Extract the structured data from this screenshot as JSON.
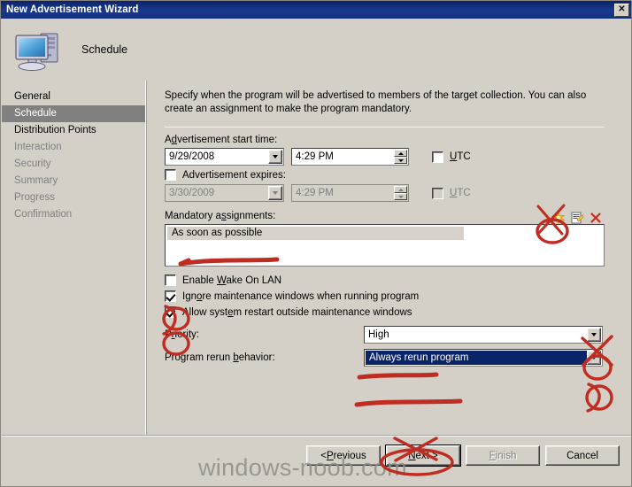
{
  "window": {
    "title": "New Advertisement Wizard",
    "close_label": "✕"
  },
  "header": {
    "title": "Schedule",
    "icon": "computer-icon"
  },
  "sidebar": {
    "items": [
      {
        "label": "General",
        "state": "enabled"
      },
      {
        "label": "Schedule",
        "state": "active"
      },
      {
        "label": "Distribution Points",
        "state": "enabled"
      },
      {
        "label": "Interaction",
        "state": "disabled"
      },
      {
        "label": "Security",
        "state": "disabled"
      },
      {
        "label": "Summary",
        "state": "disabled"
      },
      {
        "label": "Progress",
        "state": "disabled"
      },
      {
        "label": "Confirmation",
        "state": "disabled"
      }
    ]
  },
  "main": {
    "intro": "Specify when the program will be advertised to members of the target collection. You can also create an assignment to make the program mandatory.",
    "start_time": {
      "label": "Advertisement start time:",
      "date_value": "9/29/2008",
      "time_value": "4:29 PM",
      "utc_label": "UTC",
      "utc_checked": false
    },
    "expires": {
      "checkbox_label": "Advertisement expires:",
      "checked": false,
      "date_value": "3/30/2009",
      "time_value": "4:29 PM",
      "utc_label": "UTC",
      "utc_checked": false
    },
    "mandatory": {
      "label": "Mandatory assignments:",
      "items": [
        "As soon as possible"
      ],
      "toolbar": [
        {
          "name": "new-assignment-icon",
          "title": "New"
        },
        {
          "name": "properties-icon",
          "title": "Properties"
        },
        {
          "name": "delete-icon",
          "title": "Delete"
        }
      ]
    },
    "checkboxes": [
      {
        "label": "Enable Wake On LAN",
        "checked": false,
        "name": "enable-wake-on-lan"
      },
      {
        "label": "Ignore maintenance windows when running program",
        "checked": true,
        "name": "ignore-maintenance-windows"
      },
      {
        "label": "Allow system restart outside maintenance windows",
        "checked": true,
        "name": "allow-system-restart"
      }
    ],
    "priority": {
      "label": "Priority:",
      "value": "High"
    },
    "rerun": {
      "label": "Program rerun behavior:",
      "value": "Always rerun program"
    }
  },
  "footer": {
    "previous_label": "< Previous",
    "next_label": "Next >",
    "finish_label": "Finish",
    "cancel_label": "Cancel",
    "watermark": "windows-noob.com"
  },
  "colors": {
    "titlebar": "#0a246a",
    "dialog_face": "#d4d0c8",
    "nav_active": "#808080",
    "selection_blue": "#0a246a",
    "annotation_red": "#c0392b"
  }
}
